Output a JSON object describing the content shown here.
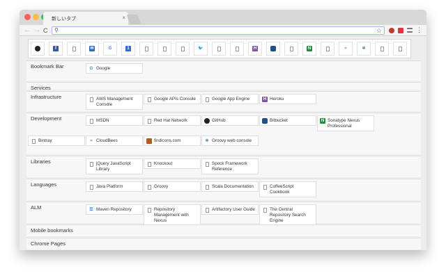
{
  "tab": {
    "title": "新しいタブ",
    "close": "×"
  },
  "toolbar": {
    "back": "←",
    "forward": "→",
    "reload": "C",
    "search_icon": "⚲",
    "star": "☆"
  },
  "colors": {
    "red": "#fc605c",
    "yellow": "#fdbc40",
    "green": "#34c84a"
  },
  "top_sites": [
    {
      "icon": "github-icon"
    },
    {
      "icon": "facebook-icon"
    },
    {
      "icon": "page-icon"
    },
    {
      "icon": "mail-icon"
    },
    {
      "icon": "google-icon"
    },
    {
      "icon": "calendar-icon"
    },
    {
      "icon": "page-icon"
    },
    {
      "icon": "page-icon"
    },
    {
      "icon": "page-icon"
    },
    {
      "icon": "twitter-icon"
    },
    {
      "icon": "page-icon"
    },
    {
      "icon": "page-icon"
    },
    {
      "icon": "heroku-icon"
    },
    {
      "icon": "bitbucket-icon"
    },
    {
      "icon": "page-icon"
    },
    {
      "icon": "nexus-icon"
    },
    {
      "icon": "page-icon"
    },
    {
      "icon": "cloudbees-icon"
    },
    {
      "icon": "groovy-icon"
    },
    {
      "icon": "page-icon"
    },
    {
      "icon": "page-icon"
    }
  ],
  "sections": [
    {
      "label": "Bookmark Bar",
      "items": [
        {
          "label": "Google",
          "icon": "google-icon"
        }
      ]
    },
    {
      "label": "Services",
      "items": []
    },
    {
      "label": "Infrastructure",
      "items": [
        {
          "label": "AWS Management Console",
          "icon": "page-icon"
        },
        {
          "label": "Google APIs Console",
          "icon": "page-icon"
        },
        {
          "label": "Google App Engine",
          "icon": "page-icon"
        },
        {
          "label": "Heroku",
          "icon": "heroku-icon"
        }
      ]
    },
    {
      "label": "Development",
      "items": [
        {
          "label": "MSDN",
          "icon": "page-icon"
        },
        {
          "label": "Red Hat Network",
          "icon": "page-icon"
        },
        {
          "label": "GitHub",
          "icon": "github-icon"
        },
        {
          "label": "Bitbucket",
          "icon": "bitbucket-icon"
        },
        {
          "label": "Sonatype Nexus Professional",
          "icon": "nexus-icon"
        },
        {
          "label": "Bintray",
          "icon": "page-icon"
        },
        {
          "label": "CloudBees",
          "icon": "cloudbees-icon"
        },
        {
          "label": "findicons.com",
          "icon": "findicons-icon"
        },
        {
          "label": "Groovy web console",
          "icon": "groovy-icon"
        }
      ]
    },
    {
      "label": "Libraries",
      "items": [
        {
          "label": "jQuery JavaScript Library",
          "icon": "page-icon"
        },
        {
          "label": "Knockout",
          "icon": "page-icon"
        },
        {
          "label": "Spock Framework Reference",
          "icon": "page-icon"
        }
      ]
    },
    {
      "label": "Languages",
      "items": [
        {
          "label": "Java Platform",
          "icon": "page-icon"
        },
        {
          "label": "Groovy",
          "icon": "page-icon"
        },
        {
          "label": "Scala Documentation",
          "icon": "page-icon"
        },
        {
          "label": "CoffeeScript Cookbook",
          "icon": "page-icon"
        }
      ]
    },
    {
      "label": "ALM",
      "items": [
        {
          "label": "Maven Repository",
          "icon": "maven-icon"
        },
        {
          "label": "Repository Management with Nexus",
          "icon": "page-icon"
        },
        {
          "label": "Artifactory User Guide",
          "icon": "page-icon"
        },
        {
          "label": "The Central Repository Search Engine",
          "icon": "page-icon"
        }
      ]
    },
    {
      "label": "Mobile bookmarks",
      "items": []
    },
    {
      "label": "Chrome Pages",
      "items": []
    }
  ]
}
